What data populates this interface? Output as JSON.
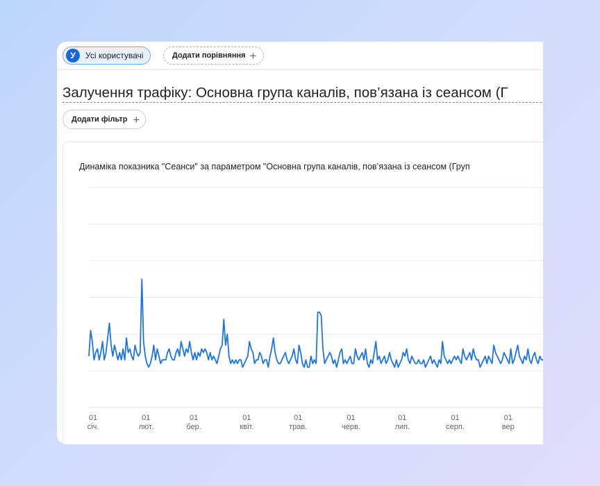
{
  "segment": {
    "avatar_letter": "У",
    "label": "Усі користувачі"
  },
  "comparison": {
    "label": "Додати порівняння"
  },
  "page_title": "Залучення трафіку: Основна група каналів, пов’язана із сеансом (Г",
  "filter": {
    "label": "Додати фільтр"
  },
  "colors": {
    "series": "#1a73e8",
    "accent": "#1a66d9"
  },
  "chart_data": {
    "type": "line",
    "title": "Динаміка показника \"Сеанси\" за параметром \"Основна група каналів, пов’язана із сеансом (Груп",
    "x_ticks": [
      {
        "day": "01",
        "month": "січ."
      },
      {
        "day": "01",
        "month": "лют."
      },
      {
        "day": "01",
        "month": "бер."
      },
      {
        "day": "01",
        "month": "квіт."
      },
      {
        "day": "01",
        "month": "трав."
      },
      {
        "day": "01",
        "month": "черв."
      },
      {
        "day": "01",
        "month": "лип."
      },
      {
        "day": "01",
        "month": "серп."
      },
      {
        "day": "01",
        "month": "вер"
      }
    ],
    "tick_days": [
      0,
      31,
      59,
      90,
      120,
      151,
      181,
      212,
      243
    ],
    "grid": true,
    "ylim": [
      0,
      6
    ],
    "series": [
      {
        "values": [
          1.4,
          2.1,
          1.8,
          1.3,
          1.5,
          1.6,
          1.3,
          1.5,
          1.8,
          1.3,
          1.5,
          1.9,
          2.3,
          1.7,
          1.4,
          1.7,
          1.5,
          1.3,
          1.5,
          1.3,
          1.6,
          1.3,
          1.9,
          1.5,
          1.6,
          1.4,
          1.3,
          1.7,
          1.5,
          1.4,
          1.5,
          3.5,
          1.8,
          1.4,
          1.2,
          1.1,
          1.2,
          1.4,
          1.7,
          1.3,
          1.6,
          1.4,
          1.2,
          1.3,
          1.3,
          1.3,
          1.5,
          1.6,
          1.4,
          1.3,
          1.3,
          1.5,
          1.6,
          1.4,
          1.8,
          1.6,
          1.4,
          1.6,
          1.5,
          1.8,
          1.5,
          1.3,
          1.5,
          1.3,
          1.5,
          1.4,
          1.6,
          1.5,
          1.6,
          1.5,
          1.3,
          1.5,
          1.3,
          1.4,
          1.3,
          1.2,
          1.4,
          1.6,
          1.7,
          2.4,
          1.7,
          2.0,
          1.4,
          1.2,
          1.3,
          1.2,
          1.3,
          1.2,
          1.3,
          1.3,
          1.1,
          1.2,
          1.3,
          1.4,
          1.8,
          1.6,
          1.5,
          1.2,
          1.3,
          1.3,
          1.5,
          1.4,
          1.2,
          1.3,
          1.3,
          1.1,
          1.4,
          1.6,
          1.9,
          1.5,
          1.3,
          1.2,
          1.2,
          1.3,
          1.4,
          1.5,
          1.3,
          1.2,
          1.3,
          1.4,
          1.6,
          1.3,
          1.2,
          1.7,
          1.5,
          1.2,
          1.1,
          1.3,
          1.1,
          1.1,
          1.4,
          1.2,
          1.3,
          1.2,
          2.6,
          2.6,
          2.5,
          1.6,
          1.2,
          1.3,
          1.4,
          1.5,
          1.4,
          1.2,
          1.3,
          1.1,
          1.3,
          1.5,
          1.6,
          1.2,
          1.3,
          1.2,
          1.3,
          1.4,
          1.2,
          1.2,
          1.6,
          1.4,
          1.3,
          1.4,
          1.5,
          1.3,
          1.6,
          1.2,
          1.1,
          1.3,
          1.2,
          1.5,
          1.8,
          1.3,
          1.4,
          1.2,
          1.3,
          1.4,
          1.2,
          1.3,
          1.5,
          1.3,
          1.2,
          1.1,
          1.3,
          1.1,
          1.2,
          1.3,
          1.5,
          1.4,
          1.6,
          1.3,
          1.2,
          1.4,
          1.3,
          1.2,
          1.2,
          1.3,
          1.2,
          1.2,
          1.3,
          1.1,
          1.2,
          1.3,
          1.4,
          1.2,
          1.3,
          1.2,
          1.1,
          1.3,
          1.2,
          1.8,
          1.4,
          1.3,
          1.2,
          1.3,
          1.2,
          1.3,
          1.4,
          1.3,
          1.4,
          1.3,
          1.2,
          1.6,
          1.4,
          1.3,
          1.4,
          1.5,
          1.3,
          1.6,
          1.4,
          1.3,
          1.3,
          1.1,
          1.2,
          1.3,
          1.4,
          1.2,
          1.4,
          1.3,
          1.2,
          1.7,
          1.5,
          1.4,
          1.3,
          1.2,
          1.3,
          1.5,
          1.4,
          1.3,
          1.2,
          1.6,
          1.2,
          1.3,
          1.5,
          1.7,
          1.4,
          1.3,
          1.2,
          1.4,
          1.3,
          1.6,
          1.3,
          1.2,
          1.4,
          1.5,
          1.3,
          1.2,
          1.4,
          1.3,
          1.3,
          1.2,
          1.4,
          1.7,
          1.5,
          1.3,
          1.4,
          1.5,
          1.3,
          1.4,
          1.3,
          1.2,
          1.3,
          1.6,
          1.4,
          1.3,
          1.5,
          1.4,
          1.8,
          2.2,
          1.5,
          1.6,
          1.4,
          1.3,
          1.5,
          1.4,
          1.3,
          1.5,
          1.4,
          1.4,
          1.3,
          1.3,
          1.2,
          1.3,
          1.5,
          1.3,
          1.4,
          1.3,
          1.2,
          1.3,
          1.2,
          1.1,
          1.2,
          1.1,
          1.2,
          1.3,
          1.2,
          1.1,
          1.2,
          1.3,
          1.2,
          1.3,
          1.4,
          1.2,
          1.3,
          1.2,
          1.4,
          1.5,
          1.3,
          1.8,
          1.7,
          2.4,
          2.2,
          1.6,
          1.7,
          1.9,
          2.0,
          1.9,
          1.7,
          1.6,
          1.5,
          1.6,
          1.4,
          1.5,
          1.7,
          1.8,
          1.6,
          1.9,
          1.8,
          1.7,
          1.9,
          1.6,
          1.5,
          1.4,
          1.5
        ]
      }
    ]
  },
  "chart_values_note": ""
}
